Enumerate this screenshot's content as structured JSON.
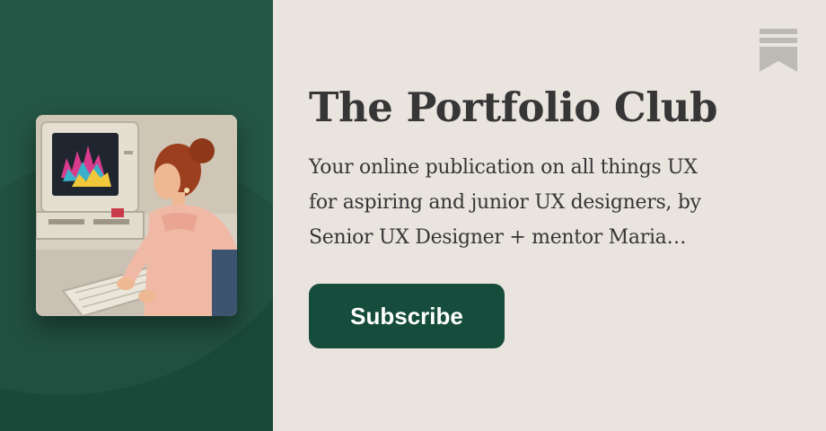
{
  "publication": {
    "title": "The Portfolio Club",
    "description_lines": [
      "Your online publication on all things UX",
      "for aspiring and junior UX designers, by",
      "Senior UX Designer + mentor Maria…"
    ]
  },
  "actions": {
    "subscribe_label": "Subscribe"
  },
  "icons": {
    "bookmark": "bookmark-icon",
    "cover": "retro-computer-illustration"
  },
  "colors": {
    "panel_green": "#1b4f3d",
    "button_green": "#164c3c",
    "background": "#e9e5de",
    "text": "#363636",
    "bookmark_gray": "#bdbab5"
  }
}
